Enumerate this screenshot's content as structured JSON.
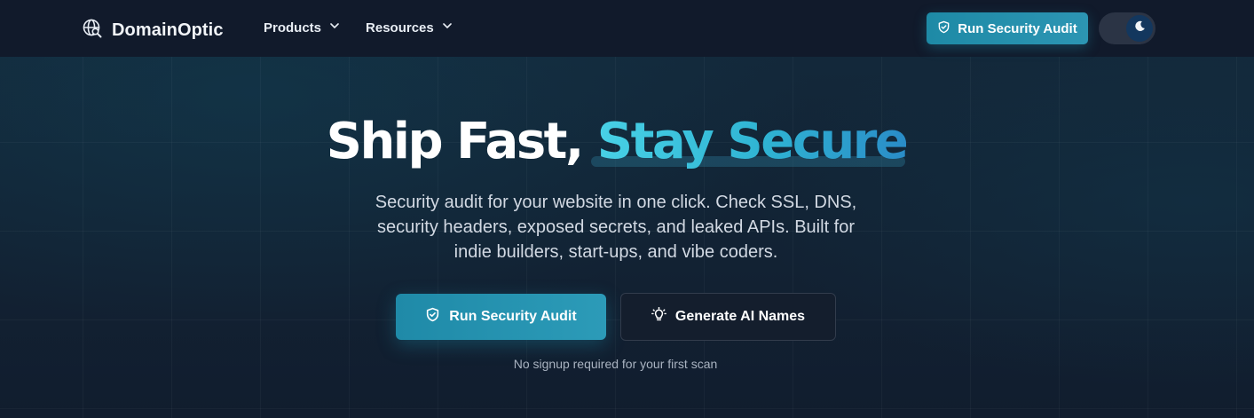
{
  "brand": {
    "name": "DomainOptic",
    "icon": "globe-search-icon"
  },
  "nav": {
    "items": [
      {
        "label": "Products",
        "icon": "chevron-down-icon"
      },
      {
        "label": "Resources",
        "icon": "chevron-down-icon"
      }
    ]
  },
  "header": {
    "cta_label": "Run Security Audit",
    "cta_icon": "shield-check-icon",
    "theme_toggle_icon": "moon-icon"
  },
  "hero": {
    "title_plain": "Ship Fast,",
    "title_accent": "Stay Secure",
    "subtitle": "Security audit for your website in one click. Check SSL, DNS, security headers, exposed secrets, and leaked APIs. Built for indie builders, start-ups, and vibe coders.",
    "primary_label": "Run Security Audit",
    "secondary_label": "Generate AI Names",
    "secondary_icon": "lightbulb-icon",
    "note": "No signup required for your first scan"
  },
  "colors": {
    "accent": "#2c95b3",
    "background": "#101a2a",
    "accent_gradient_start": "#48d1e6",
    "accent_gradient_end": "#2a8cc7"
  }
}
